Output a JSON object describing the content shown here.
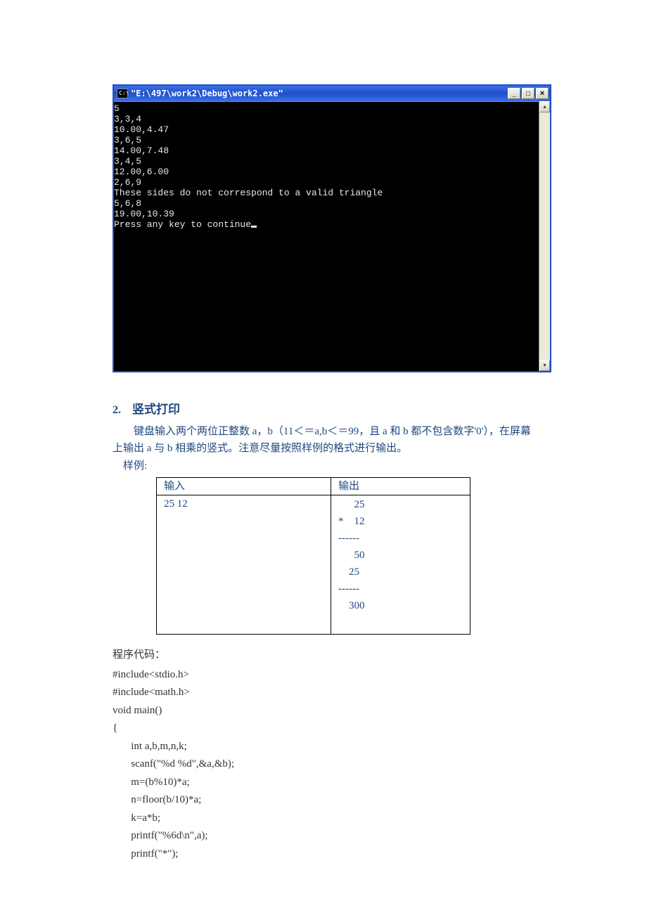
{
  "console": {
    "icon_text": "C:\\",
    "title": "\"E:\\497\\work2\\Debug\\work2.exe\"",
    "min_label": "_",
    "max_label": "□",
    "close_label": "×",
    "scroll_up": "▴",
    "scroll_down": "▾",
    "lines": [
      "5",
      "3,3,4",
      "10.00,4.47",
      "3,6,5",
      "14.00,7.48",
      "3,4,5",
      "12.00,6.00",
      "2,6,9",
      "These sides do not correspond to a valid triangle",
      "5,6,8",
      "19.00,10.39",
      "Press any key to continue"
    ]
  },
  "section": {
    "number": "2.",
    "title": "竖式打印",
    "desc_line1": "键盘输入两个两位正整数 a，b（11＜＝a,b＜＝99，且 a 和 b 都不包含数字'0'），在屏幕",
    "desc_line2": "上输出 a 与 b 相乘的竖式。注意尽量按照样例的格式进行输出。",
    "example_label": "样例:"
  },
  "table": {
    "header_input": "输入",
    "header_output": "输出",
    "input_value": "25 12",
    "output_value": "      25\n*    12\n------\n      50\n    25\n------\n    300\n "
  },
  "code": {
    "label": "程序代码：",
    "body": "#include<stdio.h>\n#include<math.h>\nvoid main()\n{\n       int a,b,m,n,k;\n       scanf(\"%d %d\",&a,&b);\n       m=(b%10)*a;\n       n=floor(b/10)*a;\n       k=a*b;\n       printf(\"%6d\\n\",a);\n       printf(\"*\");"
  }
}
